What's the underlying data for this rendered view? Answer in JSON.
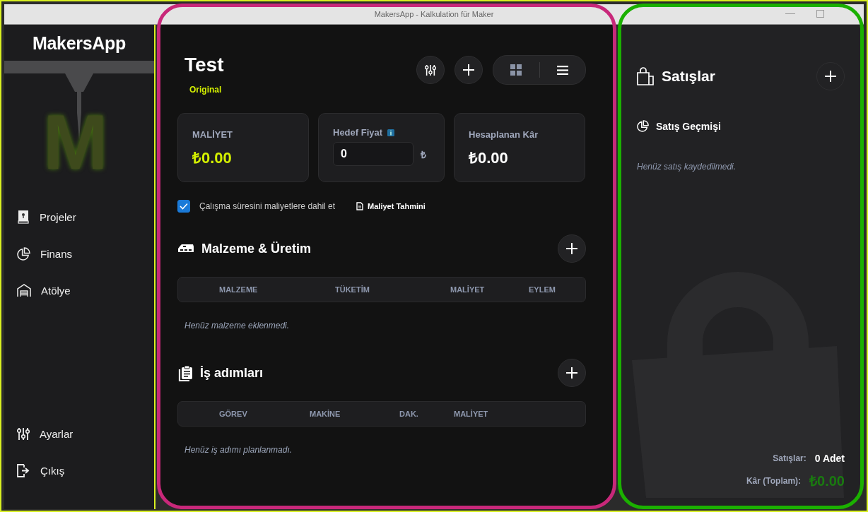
{
  "window": {
    "title": "MakersApp - Kalkulation für Maker"
  },
  "sidebar": {
    "brand": "MakersApp",
    "logo_letter": "M",
    "nav_items": [
      {
        "label": "Projeler"
      },
      {
        "label": "Finans"
      },
      {
        "label": "Atölye"
      }
    ],
    "footer_items": [
      {
        "label": "Ayarlar"
      },
      {
        "label": "Çıkış"
      }
    ]
  },
  "project": {
    "title": "Test",
    "badge": "Original",
    "view_options": [
      {
        "selected": false
      },
      {
        "selected": true
      }
    ],
    "cost": {
      "label": "MALİYET",
      "value": "₺0.00"
    },
    "target_price": {
      "label": "Hedef Fiyat",
      "value": "0",
      "unit": "₺"
    },
    "profit": {
      "label": "Hesaplanan Kâr",
      "value": "₺0.00"
    },
    "include_labor": {
      "label": "Çalışma süresini maliyetlere dahil et",
      "checked": true
    },
    "estimate_link": "Maliyet Tahmini",
    "materials": {
      "title": "Malzeme & Üretim",
      "columns": [
        "MALZEME",
        "TÜKETİM",
        "MALİYET",
        "EYLEM"
      ],
      "empty": "Henüz malzeme eklenmedi."
    },
    "steps": {
      "title": "İş adımları",
      "columns": [
        "GÖREV",
        "MAKİNE",
        "DAK.",
        "MALİYET"
      ],
      "empty": "Henüz iş adımı planlanmadı."
    }
  },
  "sales": {
    "title": "Satışlar",
    "history_title": "Satış Geçmişi",
    "empty": "Henüz satış kaydedilmedi.",
    "summary": [
      {
        "label": "Satışlar:",
        "value": "0 Adet",
        "kind": "count"
      },
      {
        "label": "Kâr (Toplam):",
        "value": "₺0.00",
        "kind": "money"
      }
    ]
  }
}
